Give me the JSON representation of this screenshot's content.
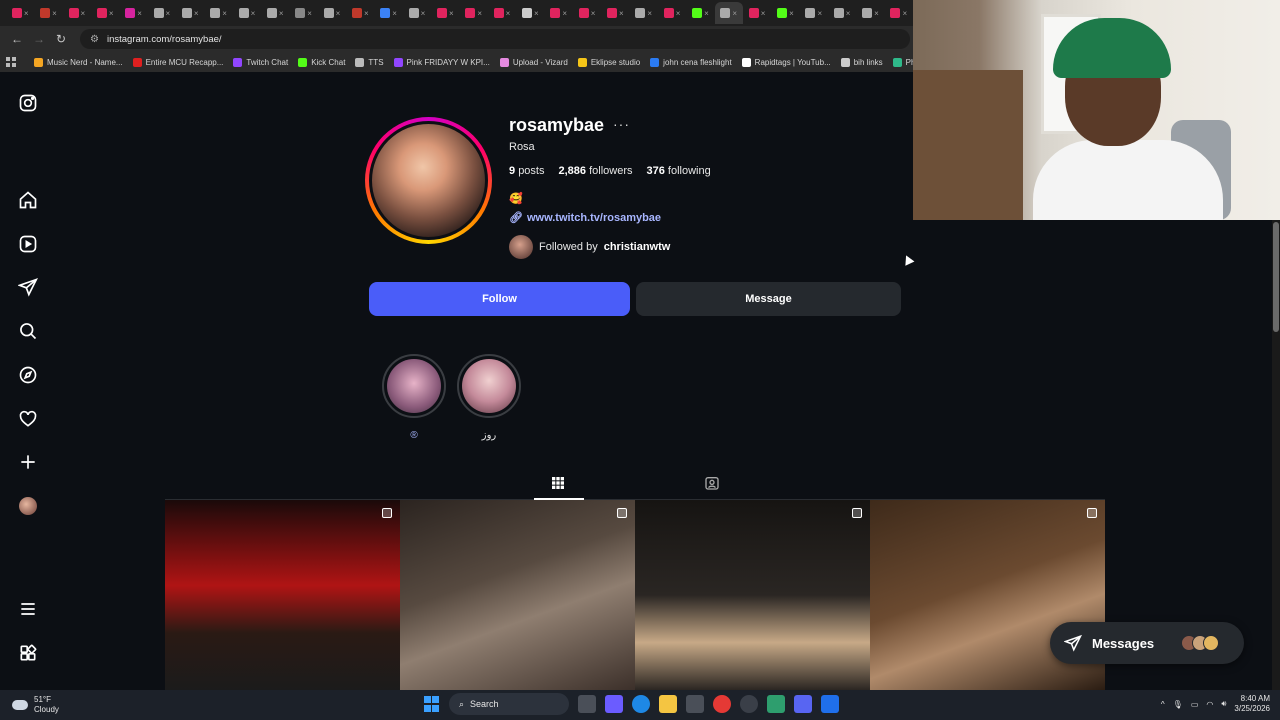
{
  "browser": {
    "url": "instagram.com/rosamybae/",
    "tab_colors": [
      "#e0245e",
      "#c0392b",
      "#e0245e",
      "#e0245e",
      "#d6249f",
      "#aaaaaa",
      "#aaaaaa",
      "#aaaaaa",
      "#aaaaaa",
      "#aaaaaa",
      "#888888",
      "#aaaaaa",
      "#c0392b",
      "#3b82f6",
      "#aaaaaa",
      "#e0245e",
      "#e0245e",
      "#e0245e",
      "#cccccc",
      "#e0245e",
      "#e0245e",
      "#e0245e",
      "#aaaaaa",
      "#e0245e",
      "#53fc18",
      "#aaaaaa",
      "#e0245e",
      "#53fc18",
      "#aaaaaa",
      "#aaaaaa",
      "#aaaaaa",
      "#e0245e"
    ],
    "bookmarks": [
      {
        "label": "Music Nerd - Name...",
        "color": "#f5a623"
      },
      {
        "label": "Entire MCU Recapp...",
        "color": "#e02020"
      },
      {
        "label": "Twitch Chat",
        "color": "#9146ff"
      },
      {
        "label": "Kick Chat",
        "color": "#53fc18"
      },
      {
        "label": "TTS",
        "color": "#bbbbbb"
      },
      {
        "label": "Pink FRIDAYY W KPI...",
        "color": "#9146ff"
      },
      {
        "label": "Upload - Vizard",
        "color": "#e58ae0"
      },
      {
        "label": "Eklipse studio",
        "color": "#f5c518"
      },
      {
        "label": "john cena fleshlight",
        "color": "#2b7bf3"
      },
      {
        "label": "Rapidtags | YouTub...",
        "color": "#ffffff"
      },
      {
        "label": "bih links",
        "color": "#cccccc"
      },
      {
        "label": "Photopea",
        "color": "#2fb98a"
      }
    ]
  },
  "profile": {
    "username": "rosamybae",
    "more": "···",
    "full_name": "Rosa",
    "posts_count": "9",
    "posts_label": "posts",
    "followers_count": "2,886",
    "followers_label": "followers",
    "following_count": "376",
    "following_label": "following",
    "bio_emoji": "🥰",
    "link": "www.twitch.tv/rosamybae",
    "followed_by_prefix": "Followed by",
    "followed_by_user": "christianwtw",
    "follow_label": "Follow",
    "message_label": "Message"
  },
  "highlights": [
    {
      "label": "®"
    },
    {
      "label": "ﺭﻭﺯ"
    }
  ],
  "messages_pill": {
    "label": "Messages"
  },
  "taskbar": {
    "temp": "51°F",
    "condition": "Cloudy",
    "search": "Search",
    "time": "8:40 AM",
    "date": "3/25/2026"
  }
}
